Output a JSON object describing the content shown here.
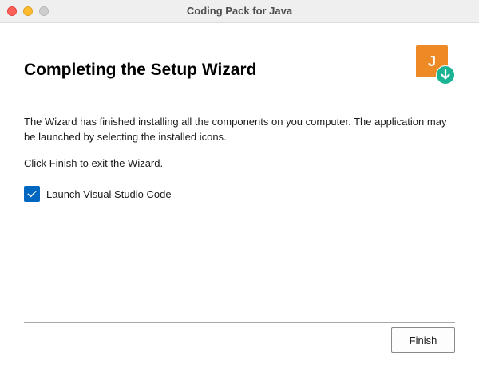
{
  "window": {
    "title": "Coding Pack for Java"
  },
  "logo": {
    "letter": "J",
    "icon": "java-download-icon",
    "colors": {
      "square": "#ee8a26",
      "badge": "#1ab394"
    }
  },
  "heading": "Completing the Setup Wizard",
  "body": {
    "paragraph1": "The Wizard has finished installing all the components on you computer. The application may be launched by selecting the installed icons.",
    "paragraph2": "Click Finish to exit the Wizard."
  },
  "launch_option": {
    "label": "Launch Visual Studio Code",
    "checked": true
  },
  "buttons": {
    "finish": "Finish"
  },
  "colors": {
    "accent": "#0067c0",
    "close": "#fe5f57",
    "minimize": "#febc2e",
    "zoom_inactive": "#cdcdcd"
  }
}
